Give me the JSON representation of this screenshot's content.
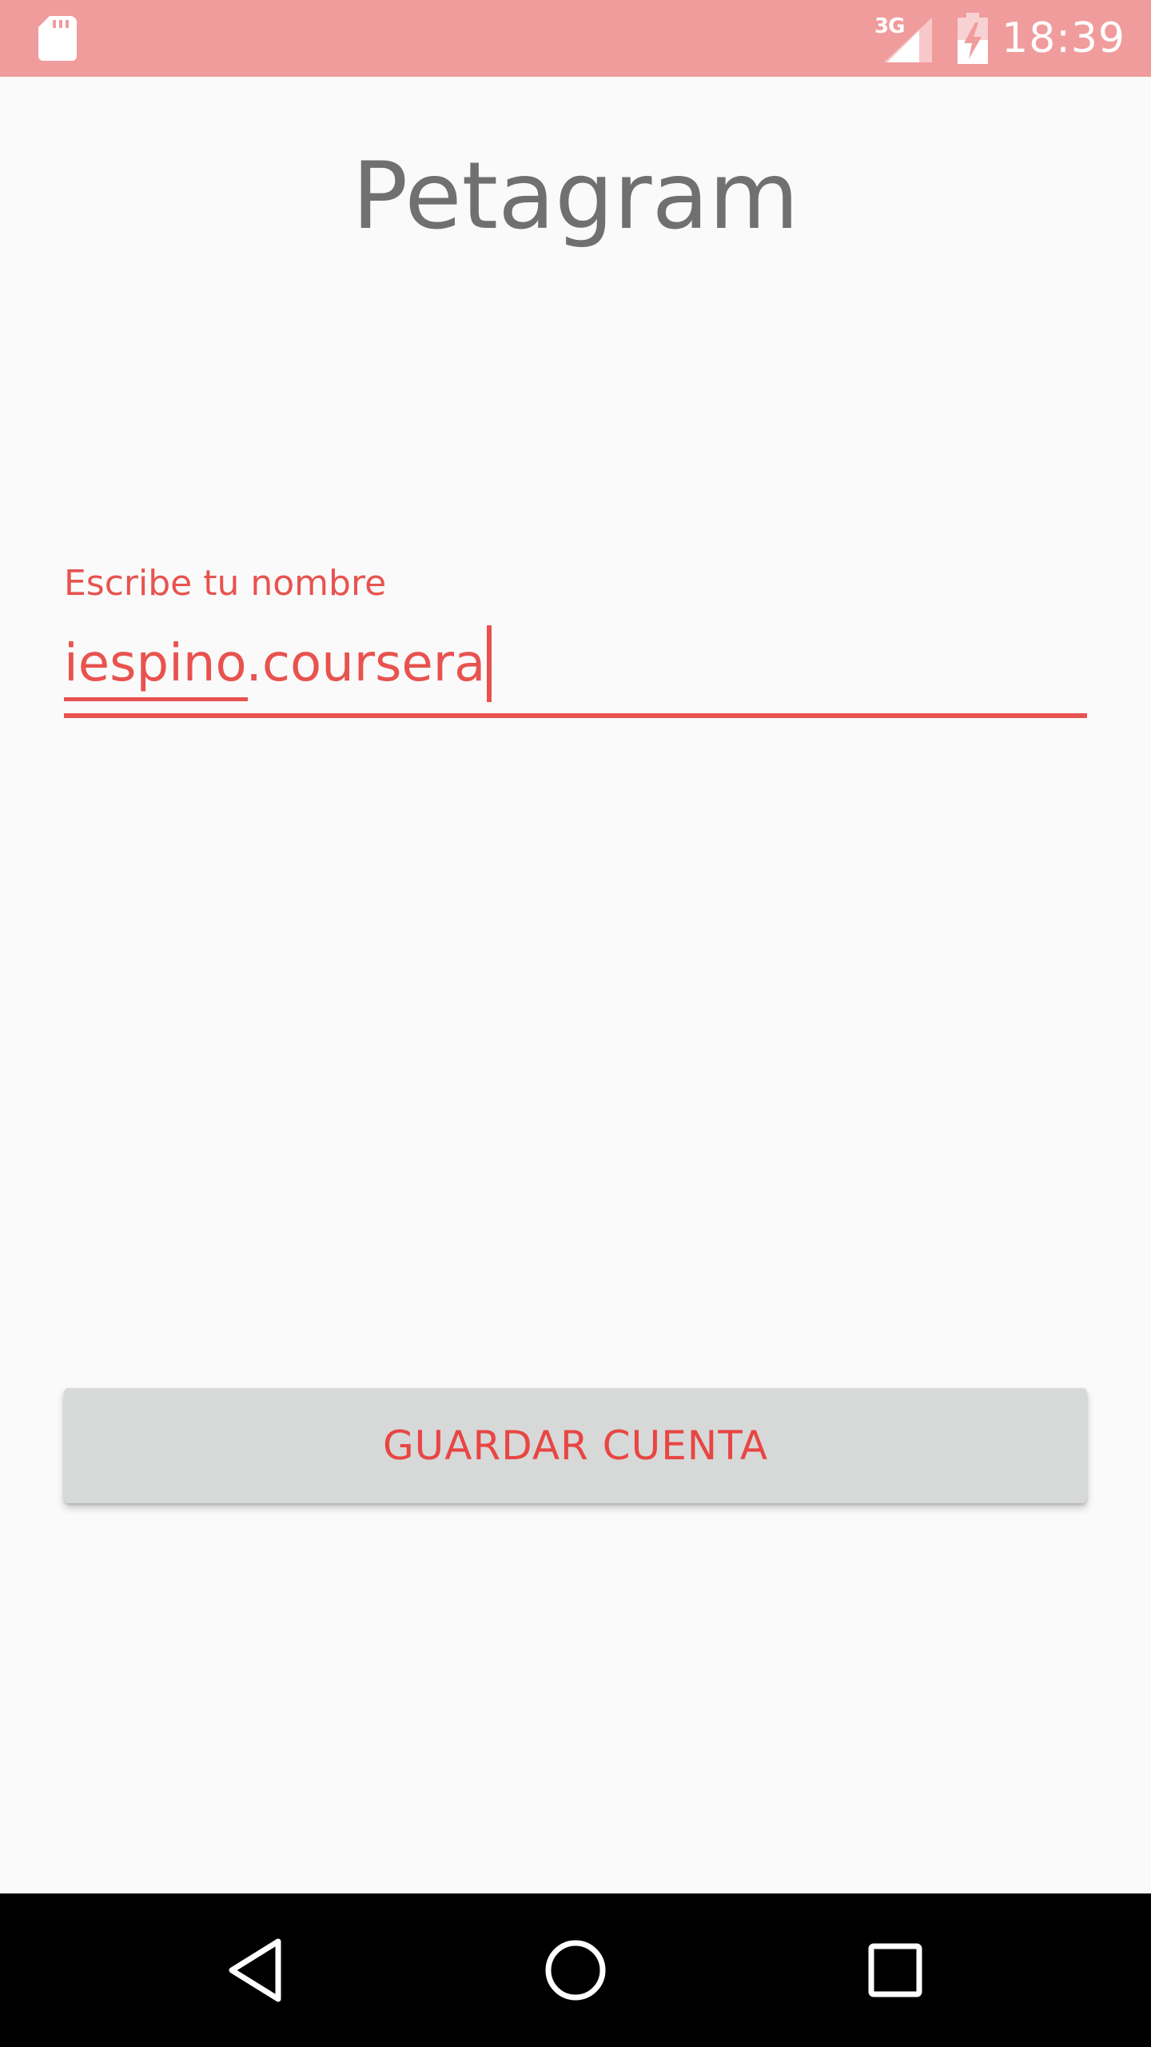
{
  "status_bar": {
    "network_label": "3G",
    "time": "18:39",
    "background_color": "#f09c9d",
    "icons": [
      "sd-card-icon",
      "signal-icon",
      "battery-charging-icon"
    ]
  },
  "app": {
    "title": "Petagram"
  },
  "form": {
    "name_label": "Escribe tu nombre",
    "name_value": "iespino.coursera",
    "accent_color": "#e8534f"
  },
  "actions": {
    "save_label": "GUARDAR CUENTA"
  },
  "nav_bar": {
    "icons": [
      "back-icon",
      "home-icon",
      "recents-icon"
    ]
  }
}
